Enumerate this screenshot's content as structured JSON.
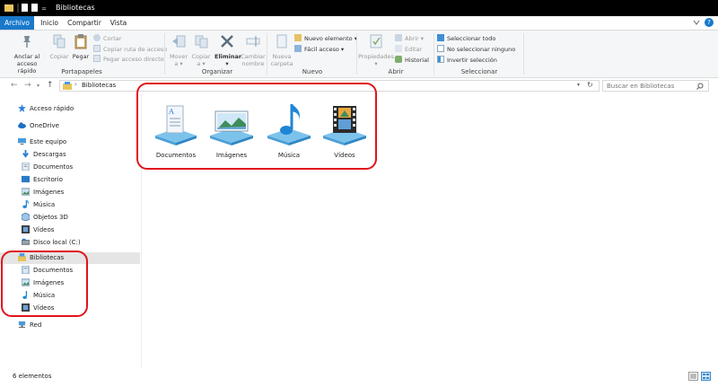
{
  "window": {
    "title": "Bibliotecas"
  },
  "tabs": [
    "Archivo",
    "Inicio",
    "Compartir",
    "Vista"
  ],
  "ribbon": {
    "portapapeles": {
      "label": "Portapapeles",
      "anclar": [
        "Anclar al",
        "acceso rápido"
      ],
      "copiar": "Copiar",
      "pegar": "Pegar",
      "cortar": "Cortar",
      "copiar_ruta": "Copiar ruta de acceso",
      "pegar_acceso": "Pegar acceso directo"
    },
    "organizar": {
      "label": "Organizar",
      "mover": [
        "Mover",
        "a ▾"
      ],
      "copiar_a": [
        "Copiar",
        "a ▾"
      ],
      "eliminar": [
        "Eliminar",
        "▾"
      ],
      "cambiar": [
        "Cambiar",
        "nombre"
      ]
    },
    "nuevo": {
      "label": "Nuevo",
      "nueva_carpeta": [
        "Nueva",
        "carpeta"
      ],
      "nuevo_elemento": "Nuevo elemento ▾",
      "facil_acceso": "Fácil acceso ▾"
    },
    "abrir": {
      "label": "Abrir",
      "propiedades": [
        "Propiedades",
        "▾"
      ],
      "abrir": "Abrir ▾",
      "editar": "Editar",
      "historial": "Historial"
    },
    "seleccionar": {
      "label": "Seleccionar",
      "todo": "Seleccionar todo",
      "ninguno": "No seleccionar ninguno",
      "invertir": "Invertir selección"
    }
  },
  "address": {
    "path": "Bibliotecas",
    "search_placeholder": "Buscar en Bibliotecas"
  },
  "nav": {
    "acceso_rapido": "Acceso rápido",
    "onedrive": "OneDrive",
    "este_equipo": "Este equipo",
    "pc_items": [
      "Descargas",
      "Documentos",
      "Escritorio",
      "Imágenes",
      "Música",
      "Objetos 3D",
      "Vídeos",
      "Disco local (C:)"
    ],
    "bibliotecas": "Bibliotecas",
    "lib_items": [
      "Documentos",
      "Imágenes",
      "Música",
      "Vídeos"
    ],
    "red": "Red"
  },
  "libraries": [
    "Documentos",
    "Imágenes",
    "Música",
    "Vídeos"
  ],
  "status": {
    "count": "6 elementos"
  },
  "colors": {
    "accent": "#1979ca",
    "highlight": "#e0141a",
    "titlebar": "#000000"
  }
}
